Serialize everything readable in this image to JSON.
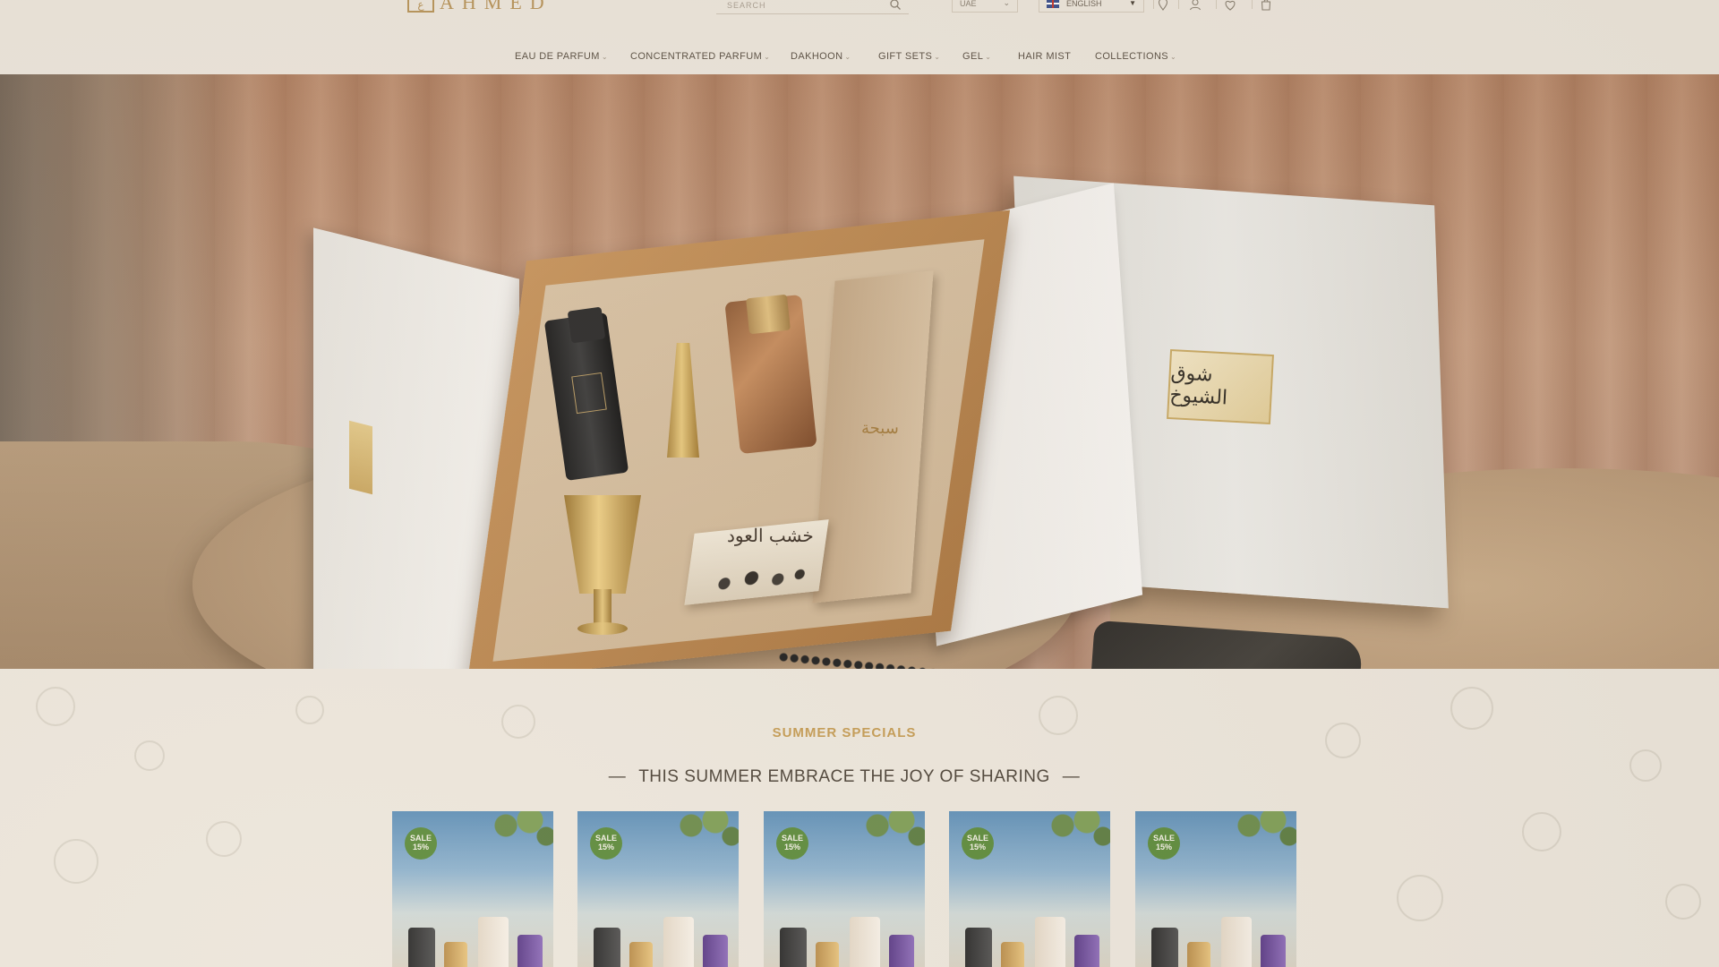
{
  "brand": {
    "logo_text": "AHMED",
    "logo_mark": "ع"
  },
  "header": {
    "search_placeholder": "SEARCH",
    "country": "UAE",
    "language": "ENGLISH",
    "icons": [
      "search-icon",
      "location-icon",
      "user-icon",
      "heart-icon",
      "cart-icon"
    ]
  },
  "nav": {
    "items": [
      {
        "label": "EAU DE PARFUM",
        "has_dropdown": true
      },
      {
        "label": "CONCENTRATED PARFUM",
        "has_dropdown": true
      },
      {
        "label": "DAKHOON",
        "has_dropdown": true
      },
      {
        "label": "GIFT SETS",
        "has_dropdown": true
      },
      {
        "label": "GEL",
        "has_dropdown": true
      },
      {
        "label": "HAIR MIST",
        "has_dropdown": false
      },
      {
        "label": "COLLECTIONS",
        "has_dropdown": true
      }
    ]
  },
  "hero": {
    "lid_text": "شوق الشيوخ",
    "misbaha_text": "سبحة",
    "wood_text": "خشب العود"
  },
  "summer": {
    "kicker": "SUMMER SPECIALS",
    "title": "THIS SUMMER EMBRACE THE JOY OF SHARING",
    "products": [
      {
        "badge_line1": "SALE",
        "badge_line2": "15%"
      },
      {
        "badge_line1": "SALE",
        "badge_line2": "15%"
      },
      {
        "badge_line1": "SALE",
        "badge_line2": "15%"
      },
      {
        "badge_line1": "SALE",
        "badge_line2": "15%"
      },
      {
        "badge_line1": "SALE",
        "badge_line2": "15%"
      }
    ]
  },
  "colors": {
    "accent_gold": "#c39a52",
    "sale_green": "#5b8a3a",
    "page_bg": "#ece6dc"
  }
}
